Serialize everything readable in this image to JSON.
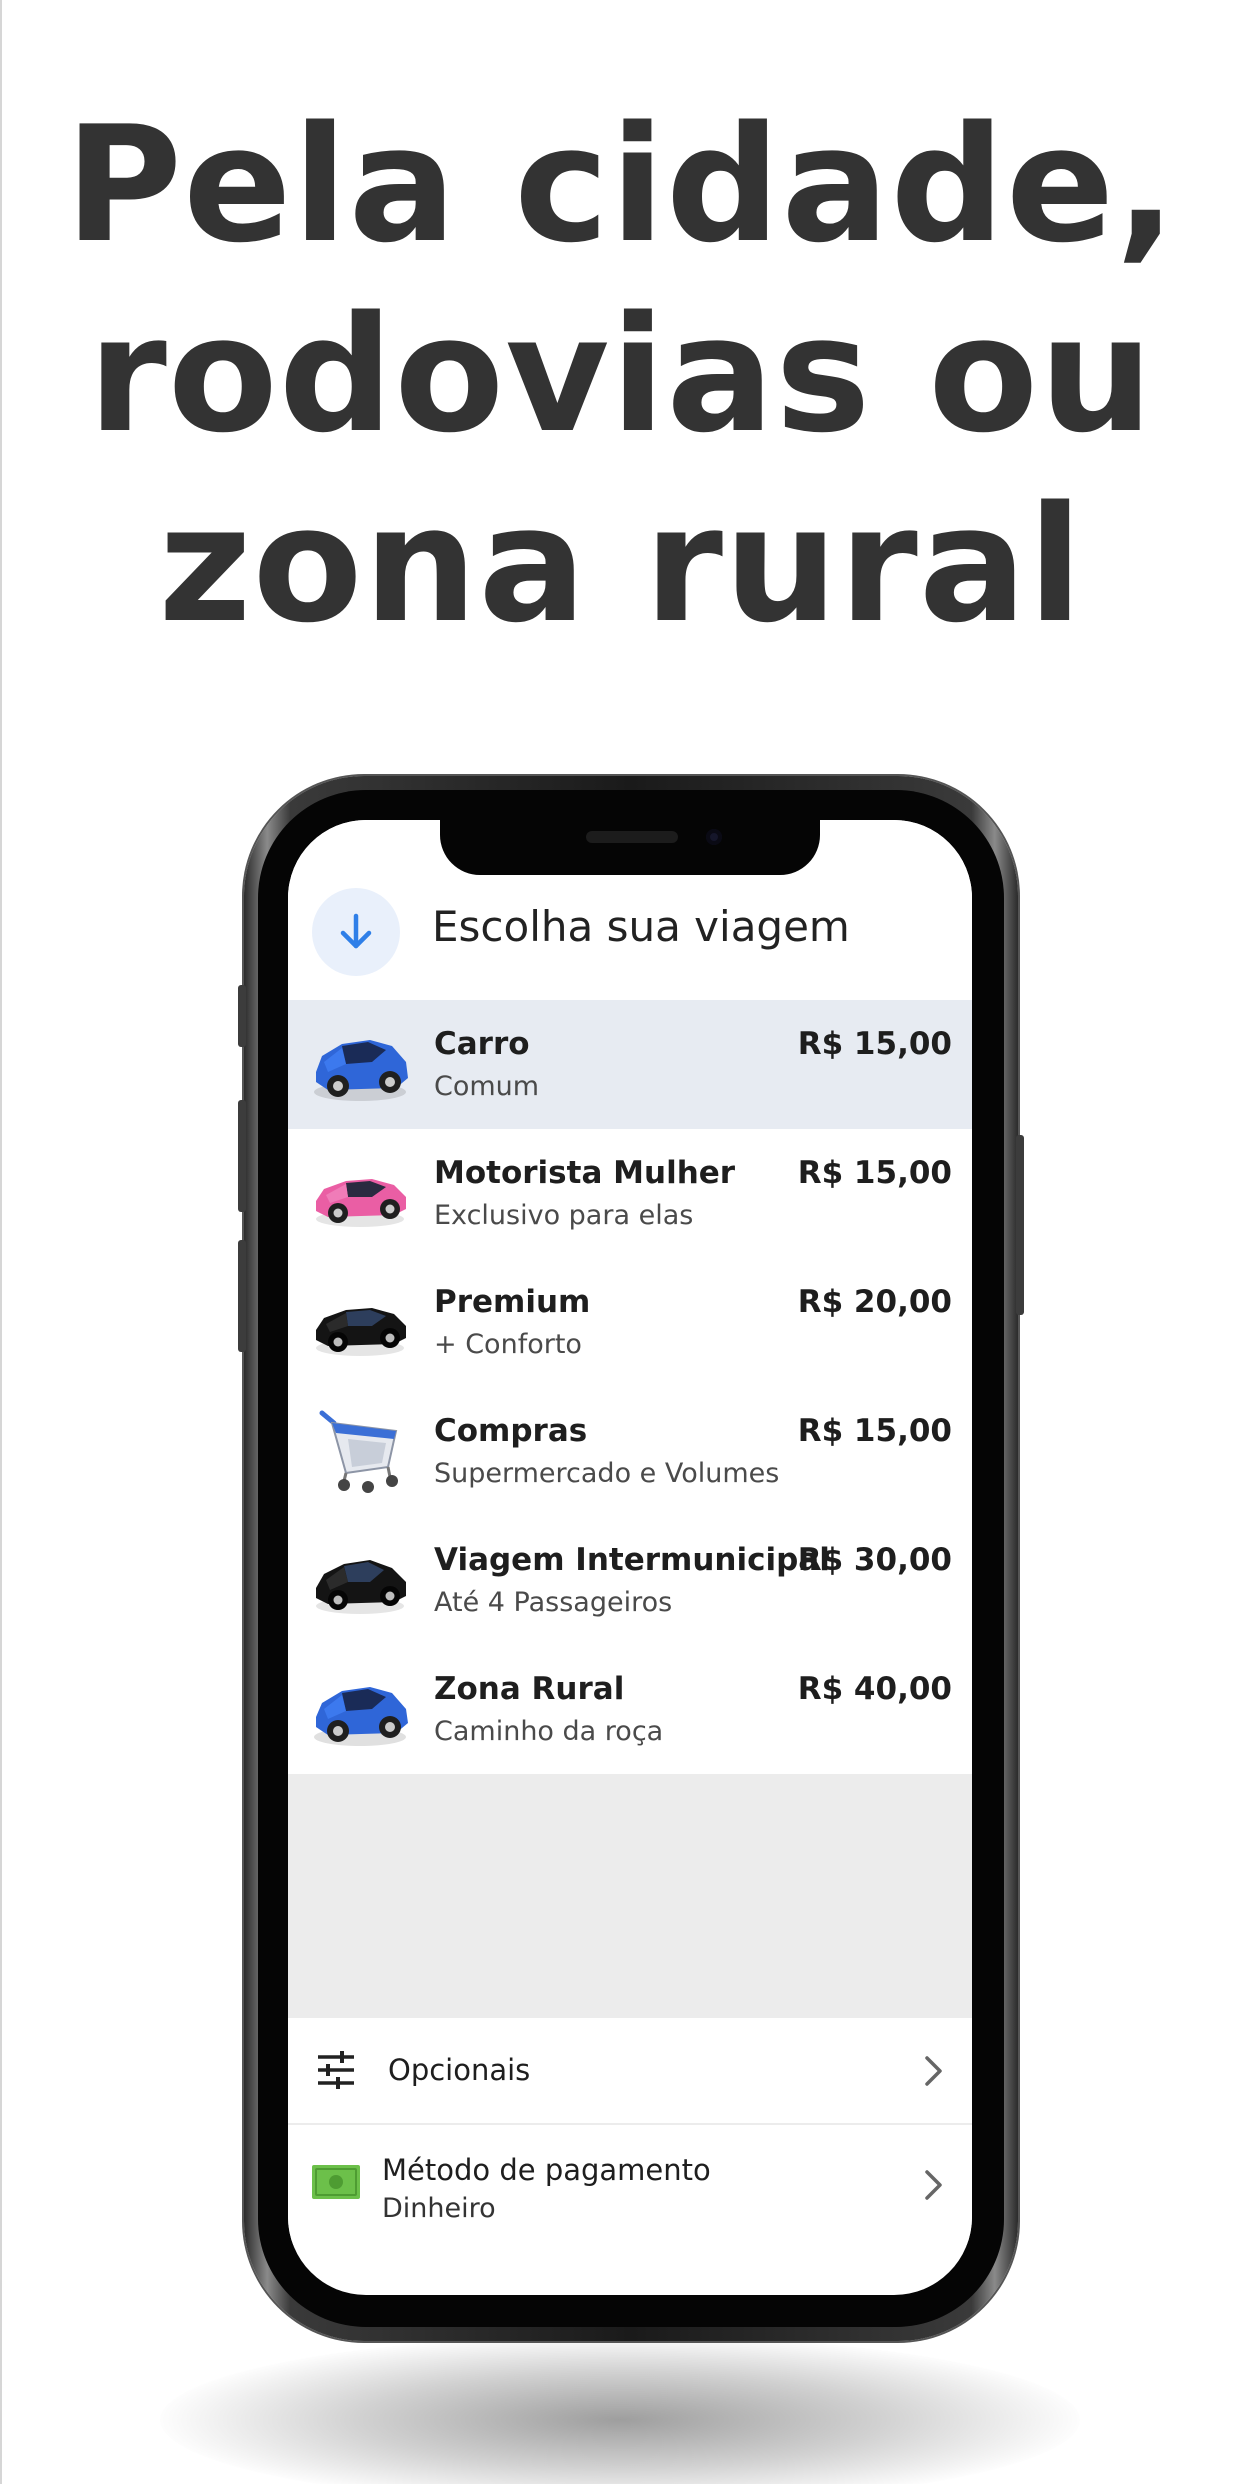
{
  "headline": {
    "line1": "Pela cidade,",
    "line2": "rodovias ou",
    "line3": "zona rural"
  },
  "app": {
    "title": "Escolha sua viagem",
    "back_icon": "arrow-down-icon",
    "accent_color": "#2f7fe8",
    "options": [
      {
        "name": "Carro",
        "subtitle": "Comum",
        "price": "R$ 15,00",
        "icon": "blue-car-icon",
        "selected": true
      },
      {
        "name": "Motorista Mulher",
        "subtitle": "Exclusivo para elas",
        "price": "R$ 15,00",
        "icon": "pink-car-icon",
        "selected": false
      },
      {
        "name": "Premium",
        "subtitle": "+ Conforto",
        "price": "R$ 20,00",
        "icon": "black-car-icon",
        "selected": false
      },
      {
        "name": "Compras",
        "subtitle": "Supermercado e Volumes",
        "price": "R$ 15,00",
        "icon": "shopping-cart-icon",
        "selected": false
      },
      {
        "name": "Viagem Intermunicipal",
        "subtitle": "Até 4 Passageiros",
        "price": "R$ 30,00",
        "icon": "black-car-icon",
        "selected": false
      },
      {
        "name": "Zona Rural",
        "subtitle": "Caminho da roça",
        "price": "R$ 40,00",
        "icon": "blue-car-icon",
        "selected": false
      }
    ],
    "optionals": {
      "label": "Opcionais",
      "icon": "sliders-icon"
    },
    "payment": {
      "label": "Método de pagamento",
      "value": "Dinheiro",
      "icon": "cash-icon"
    }
  }
}
